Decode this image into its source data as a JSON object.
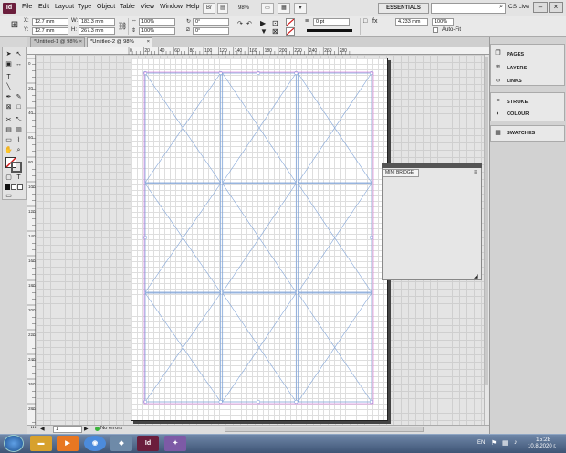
{
  "menu": {
    "app_icon": "Id",
    "items": [
      "File",
      "Edit",
      "Layout",
      "Type",
      "Object",
      "Table",
      "View",
      "Window",
      "Help"
    ],
    "zoom": "98%",
    "workspace": "ESSENTIALS",
    "cs_live": "CS Live"
  },
  "control": {
    "x_label": "X:",
    "x_value": "12.7 mm",
    "y_label": "Y:",
    "y_value": "12.7 mm",
    "w_label": "W:",
    "w_value": "183.3 mm",
    "h_label": "H:",
    "h_value": "267.3 mm",
    "scale_x": "100%",
    "scale_y": "100%",
    "rotate": "0°",
    "shear": "0°",
    "stroke_weight": "0 pt",
    "ref_width": "4.233 mm",
    "scale_x2": "100%",
    "auto_fit": "Auto-Fit"
  },
  "tabs": [
    {
      "label": "*Untitled-1 @ 98%"
    },
    {
      "label": "*Untitled-2 @ 98%"
    }
  ],
  "ruler_top_ticks": [
    "0",
    "20",
    "40",
    "60",
    "80",
    "100",
    "120",
    "140",
    "160",
    "180",
    "200",
    "220",
    "240",
    "260",
    "280"
  ],
  "ruler_left_ticks": [
    "0",
    "20",
    "40",
    "60",
    "80",
    "100",
    "120",
    "140",
    "160",
    "180",
    "200",
    "220",
    "240",
    "260",
    "280"
  ],
  "status": {
    "page": "1",
    "errors": "No errors"
  },
  "panels": {
    "group1": [
      "PAGES",
      "LAYERS",
      "LINKS"
    ],
    "group2": [
      "STROKE",
      "COLOUR"
    ],
    "group3": [
      "SWATCHES"
    ]
  },
  "bridge": {
    "title": "MINI BRIDGE"
  },
  "taskbar": {
    "indesign_label": "Id",
    "language": "EN",
    "time": "15:28",
    "date": "10.8.2020 г."
  },
  "colors": {
    "frame_line": "#7fa3d8",
    "indesign_brand": "#6b1e3c",
    "taskbar": "#3e5475"
  }
}
